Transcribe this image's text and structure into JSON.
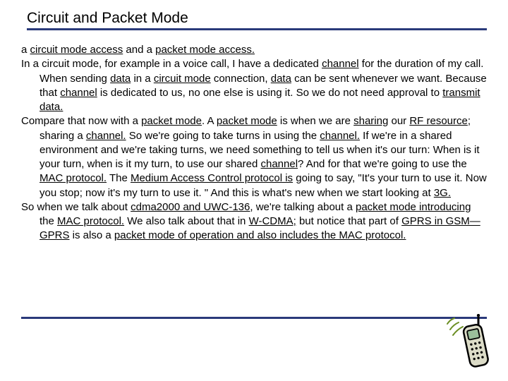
{
  "slide": {
    "title": "Circuit and Packet Mode",
    "p1_a": "a ",
    "p1_b": "circuit mode access",
    "p1_c": " and a ",
    "p1_d": "packet mode access.",
    "p2_a": "In a circuit mode, for example in a voice call, I have a dedicated ",
    "p2_b": "channel",
    "p2_c": " for the duration of my call.  When  sending ",
    "p2_d": "data",
    "p2_e": " in a ",
    "p2_f": "circuit mode",
    "p2_g": " connection, ",
    "p2_h": "data",
    "p2_i": " can be sent whenever we  want. Because that ",
    "p2_j": "channel",
    "p2_k": " is dedicated to us, no one else is using it. So we do not need approval to ",
    "p2_l": "transmit data.",
    "p3_a": "Compare that now with a ",
    "p3_b": "packet mode",
    "p3_c": ". A ",
    "p3_d": "packet mode",
    "p3_e": " is when we are ",
    "p3_f": "sharing",
    "p3_g": " our ",
    "p3_h": "RF resource",
    "p3_i": "; sharing a ",
    "p3_j": "channel.",
    "p3_k": " So we're going to take turns in using the ",
    "p3_l": "channel.",
    "p3_m": " If we're in a shared environment and we're taking turns, we need something to tell us when it's our turn: When is it your turn, when is it my turn, to use our shared ",
    "p3_n": "channel",
    "p3_o": "? And for that we're going to use the ",
    "p3_p": "MAC protocol.",
    "p3_q": " The ",
    "p3_r": "Medium Access Control protocol is",
    "p3_s": " going to say, \"It's your turn to use it. Now you stop; now it's my turn to use it. \" And this is what's new when we start looking at ",
    "p3_t": "3G.",
    "p4_a": "So when we talk about ",
    "p4_b": "cdma2000 and UWC-136,",
    "p4_c": " we're talking about a ",
    "p4_d": "packet mode introducing",
    "p4_e": " the ",
    "p4_f": "MAC protocol.",
    "p4_g": " We also talk about that in ",
    "p4_h": "W-CDMA;",
    "p4_i": " but notice that part of ",
    "p4_j": "GPRS in GSM—GPRS",
    "p4_k": " is also a ",
    "p4_l": "packet mode of operation and also includes the MAC protocol."
  },
  "icons": {
    "phone": "phone-clipart-icon"
  }
}
